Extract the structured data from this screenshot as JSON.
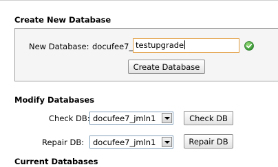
{
  "create": {
    "title": "Create New Database",
    "label": "New Database:",
    "prefix": "docufee7_",
    "input_value": "testupgrade",
    "button": "Create Database"
  },
  "modify": {
    "title": "Modify Databases",
    "check_label": "Check DB:",
    "check_value": "docufee7_jmln1",
    "check_button": "Check DB",
    "repair_label": "Repair DB:",
    "repair_value": "docufee7_jmln1",
    "repair_button": "Repair DB"
  },
  "current": {
    "title": "Current Databases"
  },
  "icons": {
    "valid": "green-check-icon",
    "dropdown": "chevron-down-icon"
  },
  "colors": {
    "input_border": "#e29a3a",
    "valid_green": "#3aa03a"
  }
}
